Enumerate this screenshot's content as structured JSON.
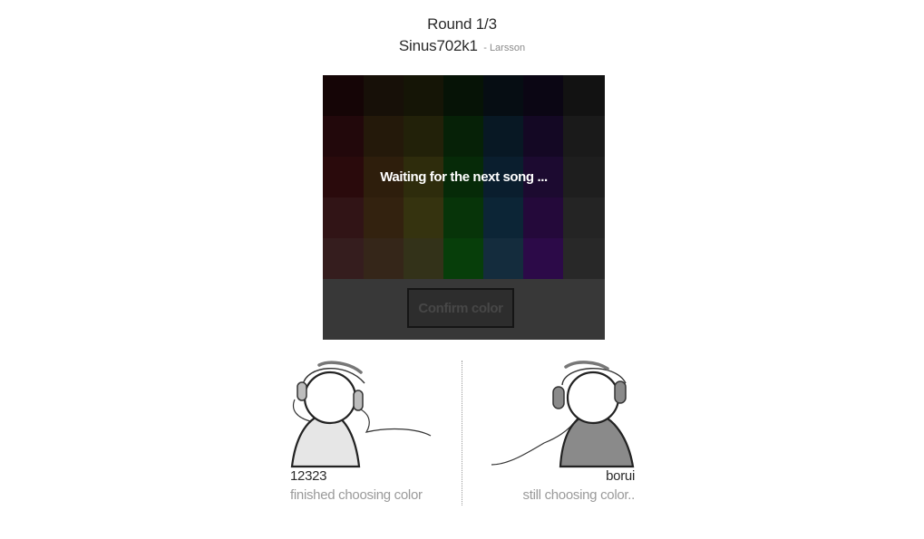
{
  "header": {
    "round": "Round 1/3",
    "song_title": "Sinus702k1",
    "song_artist": "- Larsson"
  },
  "board": {
    "waiting_text": "Waiting for the next song ...",
    "confirm_label": "Confirm color",
    "swatches": [
      [
        "#150506",
        "#171008",
        "#151506",
        "#061306",
        "#060d13",
        "#0b0614",
        "#121212"
      ],
      [
        "#22080b",
        "#24190a",
        "#222109",
        "#062107",
        "#081824",
        "#140824",
        "#1a1a1a"
      ],
      [
        "#2a0a0c",
        "#2e1e0c",
        "#2e2c0c",
        "#062a08",
        "#0a1e2e",
        "#1c0a30",
        "#1e1e1e"
      ],
      [
        "#311416",
        "#33220f",
        "#35330f",
        "#073409",
        "#0c2536",
        "#24093a",
        "#242424"
      ],
      [
        "#351d1e",
        "#352619",
        "#333219",
        "#073e0a",
        "#142c3d",
        "#2c0a48",
        "#282828"
      ]
    ]
  },
  "players": [
    {
      "name": "12323",
      "status": "finished choosing color",
      "body_color": "#e6e6e6",
      "earcup_color": "#bdbdbd"
    },
    {
      "name": "borui",
      "status": "still choosing color..",
      "body_color": "#8a8a8a",
      "earcup_color": "#8a8a8a"
    }
  ]
}
